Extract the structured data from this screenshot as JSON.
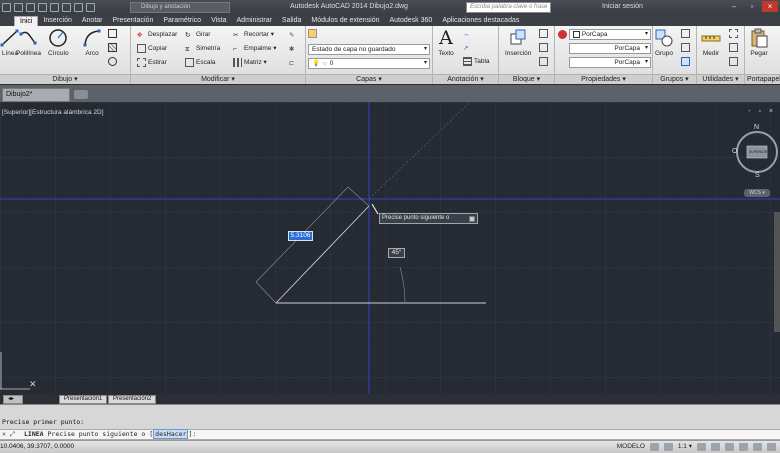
{
  "titlebar": {
    "workspace": "Dibujo y anotación",
    "title": "Autodesk AutoCAD 2014    Dibujo2.dwg",
    "search_placeholder": "Escriba palabra clave o frase",
    "login": "Iniciar sesión"
  },
  "tabs": [
    "Inici",
    "Inserción",
    "Anotar",
    "Presentación",
    "Paramétrico",
    "Vista",
    "Administrar",
    "Salida",
    "Módulos de extensión",
    "Autodesk 360",
    "Aplicaciones destacadas"
  ],
  "ribbon": {
    "draw": {
      "title": "Dibujo ▾",
      "tools": [
        "Línea",
        "Polilínea",
        "Círculo",
        "Arco"
      ]
    },
    "modify": {
      "title": "Modificar ▾",
      "rows": [
        [
          "Desplazar",
          "Girar",
          "Recortar ▾"
        ],
        [
          "Copiar",
          "Simetría",
          "Empalme ▾"
        ],
        [
          "Estirar",
          "Escala",
          "Matriz ▾"
        ]
      ]
    },
    "layers": {
      "title": "Capas ▾",
      "state": "Estado de capa no guardado",
      "current": "0"
    },
    "annotation": {
      "title": "Anotación ▾",
      "text": "Texto",
      "table": "Tabla"
    },
    "block": {
      "title": "Bloque ▾",
      "insert": "Inserción"
    },
    "properties": {
      "title": "Propiedades ▾",
      "color": "PorCapa",
      "linetype": "PorCapa",
      "lineweight": "PorCapa"
    },
    "groups": {
      "title": "Grupos ▾",
      "group": "Grupo"
    },
    "utilities": {
      "title": "Utilidades ▾",
      "measure": "Medir"
    },
    "clipboard": {
      "title": "Portapapeles",
      "paste": "Pegar"
    }
  },
  "document": {
    "tab": "Dibujo2*"
  },
  "canvas": {
    "viewport_label": "[Superior][Estructura alámbrica 2D]",
    "viewport_controls": "- ▫ ×",
    "viewcube": {
      "north": "N",
      "south": "S",
      "west": "O",
      "top": "SUPERIOR",
      "wcs": "WCS ▾"
    },
    "dynamic_length": "5.3106",
    "dynamic_angle": "45°",
    "tooltip": "Precise punto siguiente o"
  },
  "layout_tabs": [
    "Presentación1",
    "Presentación2"
  ],
  "command": {
    "history": "Precise primer punto:",
    "close": "✕ ⤢",
    "prompt_name": "LINEA",
    "prompt_text": "Precise punto siguiente o [",
    "option": "desHacer",
    "prompt_end": "]:"
  },
  "status": {
    "coords": "10.0406, 39.3707, 0.0000",
    "model": "MODELO",
    "scale": "1:1 ▾"
  },
  "colors": {
    "canvas_bg": "#252a33",
    "axis_blue": "#3140a6",
    "geometry": "#c8c8c8"
  }
}
